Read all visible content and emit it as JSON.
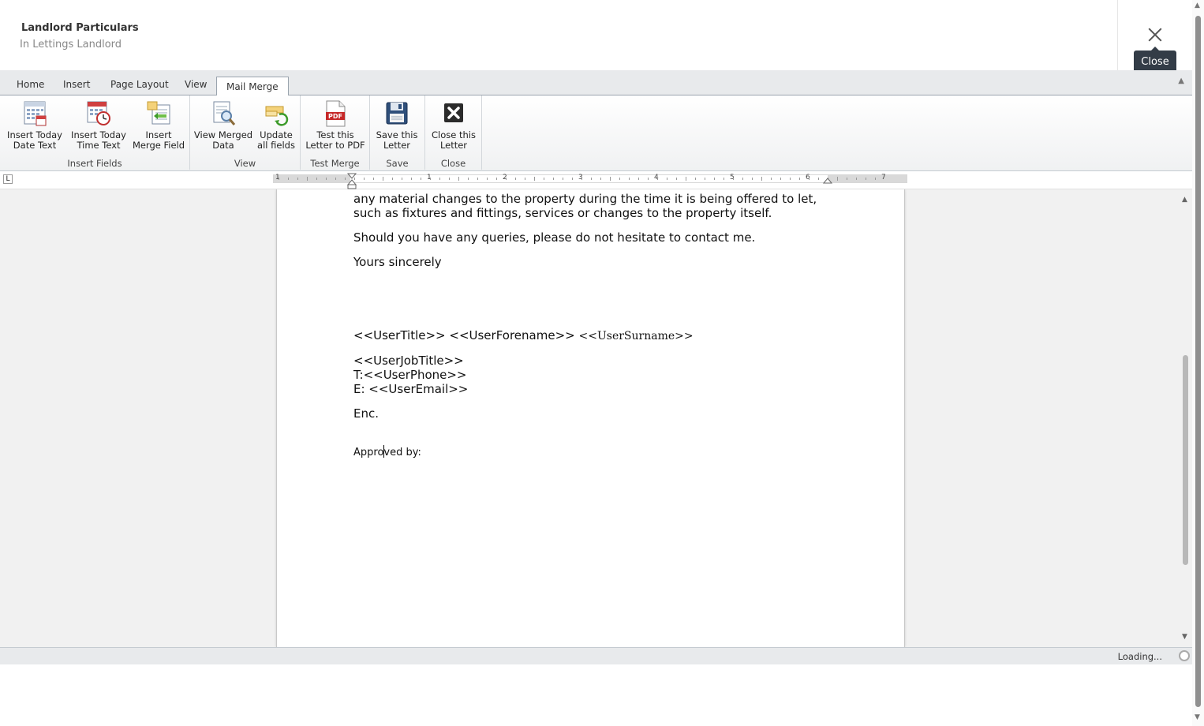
{
  "header": {
    "title": "Landlord Particulars",
    "subtitle": "In Lettings Landlord",
    "close_tooltip": "Close"
  },
  "tabs": [
    "Home",
    "Insert",
    "Page Layout",
    "View",
    "Mail Merge"
  ],
  "active_tab": "Mail Merge",
  "ribbon": {
    "insert_today_date": [
      "Insert Today",
      "Date Text"
    ],
    "insert_today_time": [
      "Insert Today",
      "Time Text"
    ],
    "insert_merge_field": [
      "Insert",
      "Merge Field"
    ],
    "view_merged_data": [
      "View Merged",
      "Data"
    ],
    "update_all_fields": [
      "Update",
      "all fields"
    ],
    "test_letter_pdf": [
      "Test this",
      "Letter to PDF"
    ],
    "save_letter": [
      "Save this",
      "Letter"
    ],
    "close_letter": [
      "Close this",
      "Letter"
    ],
    "groups": {
      "insert_fields": "Insert Fields",
      "view": "View",
      "test_merge": "Test Merge",
      "save": "Save",
      "close": "Close"
    }
  },
  "ruler": {
    "numbers": [
      "1",
      "1",
      "2",
      "3",
      "4",
      "5",
      "6",
      "7"
    ],
    "tab_selector": "L"
  },
  "document": {
    "line1": "any material changes to the property during the time it is being offered to let,",
    "line2": "such as fixtures and fittings, services or changes to the property itself.",
    "queries": "Should you have any queries, please do not hesitate to contact me.",
    "sign_off": "Yours sincerely",
    "user_title_forename": "<<UserTitle>> <<UserForename>>",
    "user_surname": "<<UserSurname>>",
    "user_job_title": "<<UserJobTitle>>",
    "user_phone": "T:<<UserPhone>>",
    "user_email": "E: <<UserEmail>>",
    "enc": "Enc.",
    "approved_a": "Appro",
    "approved_b": "ved by:"
  },
  "status": {
    "text": "Loading..."
  },
  "colors": {
    "tooltip_bg": "#333c47",
    "tab_bar": "#e8eaec",
    "workspace": "#f1f1f1"
  }
}
